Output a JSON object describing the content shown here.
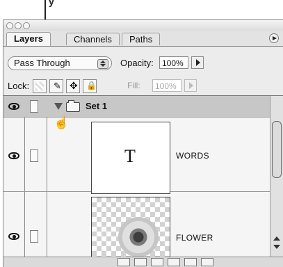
{
  "top_annotation": {
    "text": "y"
  },
  "panel": {
    "tabs": [
      {
        "label": "Layers"
      },
      {
        "label": "Channels"
      },
      {
        "label": "Paths"
      }
    ],
    "blend_mode": {
      "value": "Pass Through"
    },
    "opacity": {
      "label": "Opacity:",
      "value": "100%"
    },
    "lock": {
      "label": "Lock:"
    },
    "fill": {
      "label": "Fill:",
      "value": "100%"
    },
    "layers": [
      {
        "name": "Set 1",
        "type": "group"
      },
      {
        "name": "WORDS",
        "type": "text",
        "thumb_text": "T"
      },
      {
        "name": "FLOWER",
        "type": "image"
      }
    ]
  }
}
